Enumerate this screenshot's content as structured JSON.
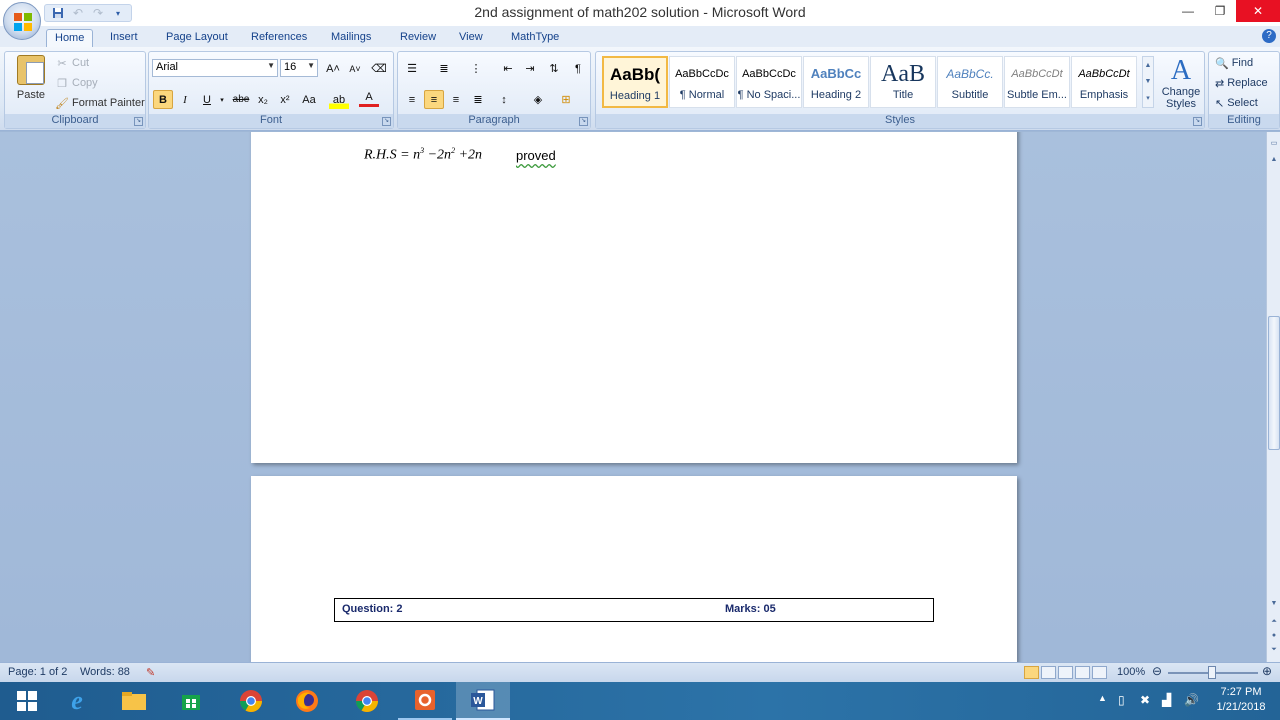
{
  "window": {
    "title": "2nd assignment of math202 solution - Microsoft Word",
    "minimize_glyph": "—",
    "restore_glyph": "❐",
    "close_glyph": "✕"
  },
  "quick_access": {
    "save_icon": "save-icon",
    "undo_icon": "undo-icon",
    "redo_icon": "redo-icon",
    "customize_icon": "customize-qat-icon"
  },
  "tabs": [
    "Home",
    "Insert",
    "Page Layout",
    "References",
    "Mailings",
    "Review",
    "View",
    "MathType"
  ],
  "active_tab": "Home",
  "clipboard": {
    "paste": "Paste",
    "cut": "Cut",
    "copy": "Copy",
    "format_painter": "Format Painter",
    "group_label": "Clipboard"
  },
  "font": {
    "name": "Arial",
    "size": "16",
    "group_label": "Font",
    "grow": "A˄",
    "shrink": "A˅",
    "bold": "B",
    "italic": "I",
    "underline": "U",
    "strikethrough": "abe",
    "subscript": "x₂",
    "superscript": "x²",
    "change_case": "Aa",
    "highlight": "ab",
    "font_color": "A"
  },
  "paragraph": {
    "group_label": "Paragraph",
    "show_marks": "¶"
  },
  "styles": {
    "group_label": "Styles",
    "items": [
      {
        "preview": "AaBb(",
        "name": "Heading 1"
      },
      {
        "preview": "AaBbCcDc",
        "name": "¶ Normal"
      },
      {
        "preview": "AaBbCcDc",
        "name": "¶ No Spaci..."
      },
      {
        "preview": "AaBbCc",
        "name": "Heading 2"
      },
      {
        "preview": "AaB",
        "name": "Title"
      },
      {
        "preview": "AaBbCc.",
        "name": "Subtitle"
      },
      {
        "preview": "AaBbCcDt",
        "name": "Subtle Em..."
      },
      {
        "preview": "AaBbCcDt",
        "name": "Emphasis"
      }
    ],
    "change_styles": "Change Styles"
  },
  "editing": {
    "group_label": "Editing",
    "find": "Find",
    "replace": "Replace",
    "select": "Select"
  },
  "document": {
    "eq_lhs": "R.H.S = n",
    "eq_exp1": "3",
    "eq_mid": " −2n",
    "eq_exp2": "2",
    "eq_end": " +2n",
    "proved": "proved",
    "question_label": "Question: 2",
    "marks_label": "Marks: 05"
  },
  "status": {
    "page": "Page: 1 of 2",
    "words": "Words: 88",
    "zoom": "100%"
  },
  "taskbar": {
    "apps": [
      "start",
      "internet-explorer",
      "file-explorer",
      "store",
      "chrome-beta",
      "firefox",
      "chrome",
      "office",
      "word"
    ],
    "time": "7:27 PM",
    "date": "1/21/2018"
  }
}
